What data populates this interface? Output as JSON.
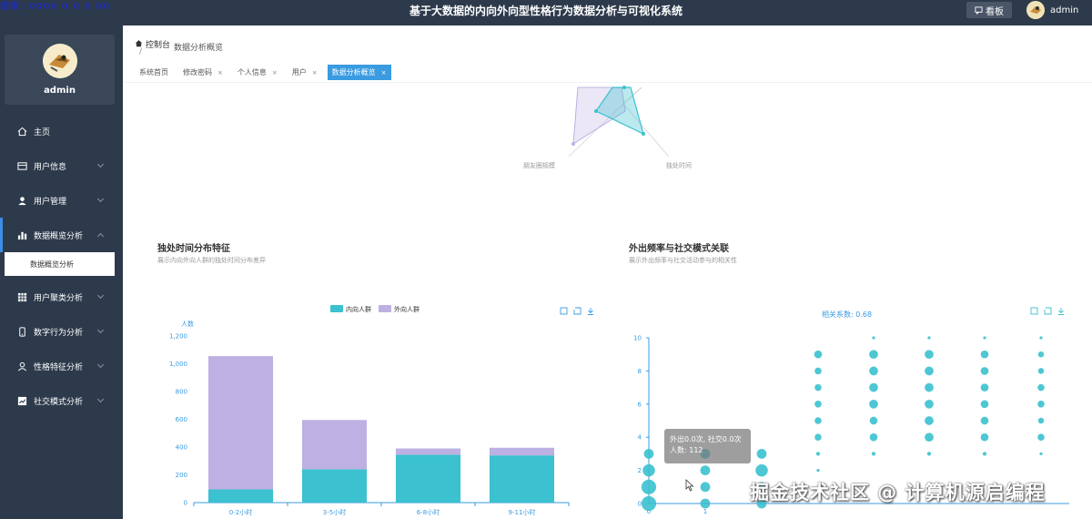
{
  "topbar": {
    "corner_text": "搜索: 0000 0 0 0 00",
    "title": "基于大数据的内向外向型性格行为数据分析与可视化系统",
    "board_label": "看板",
    "username": "admin"
  },
  "sidebar": {
    "profile_name": "admin",
    "items": [
      {
        "label": "主页",
        "icon": "home-icon"
      },
      {
        "label": "用户信息",
        "icon": "card-icon"
      },
      {
        "label": "用户管理",
        "icon": "user-icon"
      },
      {
        "label": "数据概览分析",
        "icon": "bar-chart-icon"
      },
      {
        "label": "数据概览分析"
      },
      {
        "label": "用户聚类分析",
        "icon": "grid-icon"
      },
      {
        "label": "数字行为分析",
        "icon": "phone-icon"
      },
      {
        "label": "性格特征分析",
        "icon": "person-icon"
      },
      {
        "label": "社交模式分析",
        "icon": "chart-icon"
      }
    ]
  },
  "breadcrumb": {
    "root": "控制台",
    "sep": "/",
    "current": "数据分析概览"
  },
  "tabs": [
    {
      "label": "系统首页"
    },
    {
      "label": "修改密码",
      "close": "×"
    },
    {
      "label": "个人信息",
      "close": "×"
    },
    {
      "label": "用户",
      "close": "×"
    },
    {
      "label": "数据分析概览",
      "close": "×"
    }
  ],
  "radar": {
    "labels": [
      "朋友圈规模",
      "独处时间"
    ]
  },
  "chart1": {
    "title": "独处时间分布特征",
    "subtitle": "展示内向外向人群的独处时间分布差异"
  },
  "chart2": {
    "title": "外出频率与社交模式关联",
    "subtitle": "展示外出频率与社交活动参与的相关性",
    "correlation": "相关系数: 0.68",
    "tooltip_line1": "外出0.0次, 社交0.0次",
    "tooltip_line2": "人数: 112"
  },
  "watermark": "掘金技术社区 @ 计算机源启编程",
  "colors": {
    "introvert": "#3bc1cf",
    "extrovert": "#bdb0e2",
    "accent": "#3a9be0",
    "sidebar": "#2d3a4b"
  },
  "chart_data": [
    {
      "type": "bar",
      "stacked": true,
      "categories": [
        "0-2小时",
        "3-5小时",
        "6-8小时",
        "9-11小时"
      ],
      "series": [
        {
          "name": "内向人群",
          "values": [
            95,
            240,
            345,
            340
          ]
        },
        {
          "name": "外向人群",
          "values": [
            960,
            355,
            45,
            55
          ]
        }
      ],
      "ylabel": "人数",
      "ylim": [
        0,
        1200
      ],
      "yticks": [
        "0",
        "200",
        "400",
        "600",
        "800",
        "1,000",
        "1,200"
      ],
      "legend": "top-center"
    },
    {
      "type": "scatter",
      "yticks": [
        "0",
        "2",
        "4",
        "6",
        "8",
        "10"
      ],
      "ylim": [
        0,
        10
      ],
      "xlim": [
        0,
        7
      ],
      "xticks": [
        "0",
        "1"
      ],
      "points": [
        {
          "x": 0,
          "y": 0,
          "r": 3
        },
        {
          "x": 0,
          "y": 1,
          "r": 3
        },
        {
          "x": 0,
          "y": 2,
          "r": 2.5
        },
        {
          "x": 0,
          "y": 3,
          "r": 2
        },
        {
          "x": 1,
          "y": 0,
          "r": 2
        },
        {
          "x": 1,
          "y": 1,
          "r": 2
        },
        {
          "x": 1,
          "y": 2,
          "r": 2
        },
        {
          "x": 1,
          "y": 3,
          "r": 2
        },
        {
          "x": 2,
          "y": 0,
          "r": 2
        },
        {
          "x": 2,
          "y": 1,
          "r": 2
        },
        {
          "x": 2,
          "y": 2,
          "r": 2.5
        },
        {
          "x": 2,
          "y": 3,
          "r": 2
        },
        {
          "x": 3,
          "y": 2,
          "r": 0.6
        },
        {
          "x": 3,
          "y": 3,
          "r": 0.8
        },
        {
          "x": 3,
          "y": 4,
          "r": 1.4
        },
        {
          "x": 3,
          "y": 5,
          "r": 1.4
        },
        {
          "x": 3,
          "y": 6,
          "r": 1.4
        },
        {
          "x": 3,
          "y": 7,
          "r": 1.4
        },
        {
          "x": 3,
          "y": 8,
          "r": 1.4
        },
        {
          "x": 3,
          "y": 9,
          "r": 1.6
        },
        {
          "x": 4,
          "y": 3,
          "r": 0.8
        },
        {
          "x": 4,
          "y": 4,
          "r": 1.6
        },
        {
          "x": 4,
          "y": 5,
          "r": 1.6
        },
        {
          "x": 4,
          "y": 6,
          "r": 1.8
        },
        {
          "x": 4,
          "y": 7,
          "r": 1.8
        },
        {
          "x": 4,
          "y": 8,
          "r": 1.8
        },
        {
          "x": 4,
          "y": 9,
          "r": 1.8
        },
        {
          "x": 4,
          "y": 10,
          "r": 0.6
        },
        {
          "x": 5,
          "y": 3,
          "r": 0.8
        },
        {
          "x": 5,
          "y": 4,
          "r": 1.8
        },
        {
          "x": 5,
          "y": 5,
          "r": 1.8
        },
        {
          "x": 5,
          "y": 6,
          "r": 1.8
        },
        {
          "x": 5,
          "y": 7,
          "r": 1.8
        },
        {
          "x": 5,
          "y": 8,
          "r": 1.8
        },
        {
          "x": 5,
          "y": 9,
          "r": 1.8
        },
        {
          "x": 5,
          "y": 10,
          "r": 0.6
        },
        {
          "x": 6,
          "y": 3,
          "r": 0.8
        },
        {
          "x": 6,
          "y": 4,
          "r": 1.6
        },
        {
          "x": 6,
          "y": 5,
          "r": 1.6
        },
        {
          "x": 6,
          "y": 6,
          "r": 1.6
        },
        {
          "x": 6,
          "y": 7,
          "r": 1.6
        },
        {
          "x": 6,
          "y": 8,
          "r": 1.6
        },
        {
          "x": 6,
          "y": 9,
          "r": 1.6
        },
        {
          "x": 6,
          "y": 10,
          "r": 0.6
        },
        {
          "x": 7,
          "y": 3,
          "r": 0.6
        },
        {
          "x": 7,
          "y": 4,
          "r": 1.4
        },
        {
          "x": 7,
          "y": 5,
          "r": 1.2
        },
        {
          "x": 7,
          "y": 6,
          "r": 1.4
        },
        {
          "x": 7,
          "y": 7,
          "r": 1.4
        },
        {
          "x": 7,
          "y": 8,
          "r": 1.2
        },
        {
          "x": 7,
          "y": 9,
          "r": 1.2
        },
        {
          "x": 7,
          "y": 10,
          "r": 0.6
        }
      ]
    }
  ]
}
